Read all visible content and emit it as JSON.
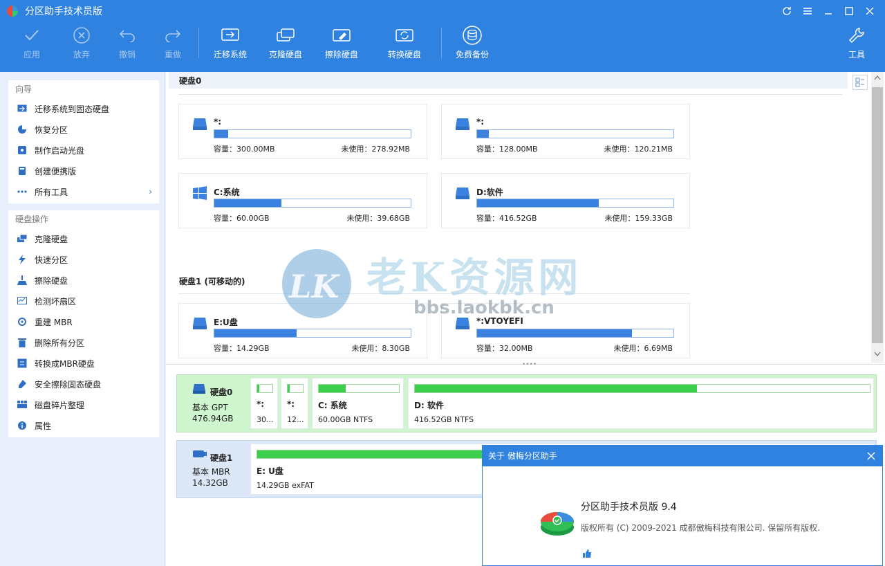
{
  "app": {
    "title": "分区助手技术员版"
  },
  "toolbar": {
    "apply": "应用",
    "discard": "放弃",
    "undo": "撤销",
    "redo": "重做",
    "migrate": "迁移系统",
    "clone": "克隆硬盘",
    "wipe": "擦除硬盘",
    "convert": "转换硬盘",
    "backup": "免费备份",
    "tools": "工具"
  },
  "sidebar": {
    "wizard_head": "向导",
    "wizard_items": [
      "迁移系统到固态硬盘",
      "恢复分区",
      "制作启动光盘",
      "创建便携版",
      "所有工具"
    ],
    "diskops_head": "硬盘操作",
    "diskops_items": [
      "克隆硬盘",
      "快速分区",
      "擦除硬盘",
      "检测坏扇区",
      "重建 MBR",
      "删除所有分区",
      "转换成MBR硬盘",
      "安全擦除固态硬盘",
      "磁盘碎片整理",
      "属性"
    ]
  },
  "main": {
    "disk0_head": "硬盘0",
    "disk1_head": "硬盘1 (可移动的)",
    "disk0_parts": [
      {
        "name": "*:",
        "capacity": "容量：300.00MB",
        "free": "未使用：278.92MB",
        "used_frac": 0.07
      },
      {
        "name": "*:",
        "capacity": "容量：128.00MB",
        "free": "未使用：120.21MB",
        "used_frac": 0.06
      },
      {
        "name": "C:系统",
        "capacity": "容量：60.00GB",
        "free": "未使用：39.68GB",
        "used_frac": 0.34
      },
      {
        "name": "D:软件",
        "capacity": "容量：416.52GB",
        "free": "未使用：159.33GB",
        "used_frac": 0.62
      }
    ],
    "disk1_parts": [
      {
        "name": "E:U盘",
        "capacity": "容量：14.29GB",
        "free": "未使用：8.30GB",
        "used_frac": 0.42
      },
      {
        "name": "*:VTOYEFI",
        "capacity": "容量：32.00MB",
        "free": "未使用：6.69MB",
        "used_frac": 0.79
      }
    ]
  },
  "bottom": {
    "disk0": {
      "name": "硬盘0",
      "type": "基本 GPT",
      "size": "476.94GB",
      "parts": [
        {
          "name": "*:",
          "detail": "30...",
          "used_frac": 0.15
        },
        {
          "name": "*:",
          "detail": "12...",
          "used_frac": 0.15
        },
        {
          "name": "C: 系统",
          "detail": "60.00GB NTFS",
          "used_frac": 0.34
        },
        {
          "name": "D: 软件",
          "detail": "416.52GB NTFS",
          "used_frac": 0.62
        }
      ]
    },
    "disk1": {
      "name": "硬盘1",
      "type": "基本 MBR",
      "size": "14.32GB",
      "parts": [
        {
          "name": "E: U盘",
          "detail": "14.29GB exFAT",
          "used_frac": 0.42
        }
      ]
    }
  },
  "dialog": {
    "title": "关于 傲梅分区助手",
    "product": "分区助手技术员版 9.4",
    "copyright": "版权所有 (C) 2009-2021 成都傲梅科技有限公司. 保留所有版权."
  },
  "watermark": {
    "text": "老K资源网",
    "url": "bbs.laokbk.cn",
    "logo_letters": "LK"
  },
  "colors": {
    "accent": "#2f82e0",
    "used_bar": "#3b82e0",
    "green_bar": "#3ccf4e"
  }
}
